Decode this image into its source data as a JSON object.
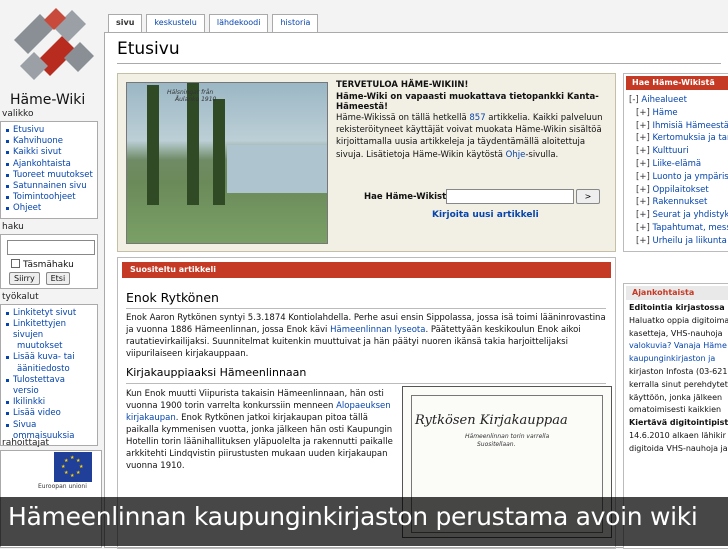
{
  "site": {
    "name": "Häme-Wiki"
  },
  "tabs": [
    "sivu",
    "keskustelu",
    "lähdekoodi",
    "historia"
  ],
  "page_title": "Etusivu",
  "sidebar": {
    "nav_title": "valikko",
    "nav_items": [
      "Etusivu",
      "Kahvihuone",
      "Kaikki sivut",
      "Ajankohtaista",
      "Tuoreet muutokset",
      "Satunnainen sivu",
      "Toimintoohjeet",
      "Ohjeet"
    ],
    "search_title": "haku",
    "search_caption": "Täsmähaku",
    "search_go": "Siirry",
    "search_find": "Etsi",
    "tools_title": "työkalut",
    "tools_items": [
      "Linkitetyt sivut",
      "Linkitettyjen sivujen",
      "muutokset",
      "Lisää kuva- tai",
      "äänitiedosto",
      "Tulostettava versio",
      "Ikilinkki",
      "Lisää video",
      "Sivua ommaisuuksia"
    ],
    "sponsors_title": "rahoittajat",
    "eu_label": "Euroopan unioni"
  },
  "welcome": {
    "photo_caption1": "Hälsningar från",
    "photo_caption2": "Åulanko 1910",
    "heading": "TERVETULOA HÄME-WIKIIN!",
    "subheading": "Häme-Wiki on vapaasti muokattava tietopankki Kanta-Hämeestä!",
    "body_before": "Häme-Wikissä on tällä hetkellä ",
    "article_count": "857",
    "body_middle": " artikkelia. Kaikki palveluun rekisteröityneet käyttäjät voivat muokata Häme-Wikin sisältöä kirjoittamalla uusia artikkeleja ja täydentämällä aloitettuja sivuja. Lisätietoja Häme-Wikin käytöstä ",
    "help_link": "Ohje",
    "body_after": "-sivulla.",
    "search_label": "Hae Häme-Wikistä",
    "search_button": ">",
    "new_article": "Kirjoita uusi artikkeli"
  },
  "portal": {
    "title": "Hae Häme-Wikistä",
    "items": [
      {
        "mark": "[-]",
        "label": "Aihealueet",
        "indent": false
      },
      {
        "mark": "[+]",
        "label": "Häme",
        "indent": true
      },
      {
        "mark": "[+]",
        "label": "Ihmisiä Hämeestä",
        "indent": true
      },
      {
        "mark": "[+]",
        "label": "Kertomuksia ja tar",
        "indent": true
      },
      {
        "mark": "[+]",
        "label": "Kulttuuri",
        "indent": true
      },
      {
        "mark": "[+]",
        "label": "Liike-elämä",
        "indent": true
      },
      {
        "mark": "[+]",
        "label": "Luonto ja ympärist",
        "indent": true
      },
      {
        "mark": "[+]",
        "label": "Oppilaitokset",
        "indent": true
      },
      {
        "mark": "[+]",
        "label": "Rakennukset",
        "indent": true
      },
      {
        "mark": "[+]",
        "label": "Seurat ja yhdistyks",
        "indent": true
      },
      {
        "mark": "[+]",
        "label": "Tapahtumat, mess",
        "indent": true
      },
      {
        "mark": "[+]",
        "label": "Urheilu ja liikunta",
        "indent": true
      }
    ]
  },
  "featured": {
    "header": "Suositeltu artikkeli",
    "title": "Enok Rytkönen",
    "p1_a": "Enok Aaron Rytkönen syntyi 5.3.1874 Kontiolahdella. Perhe asui ensin Sippolassa, jossa isä toimi lääninrovastina ja vuonna 1886 Hämeenlinnan, jossa Enok kävi ",
    "p1_link": "Hämeenlinnan lyseota",
    "p1_b": ". Päätettyään keskikoulun Enok aikoi rautatievirkailijaksi. Suunnitelmat kuitenkin muuttuivat ja hän päätyi nuoren ikänsä takia harjoittelijaksi viipurilaiseen kirjakauppaan.",
    "subtitle": "Kirjakauppiaaksi Hämeenlinnaan",
    "p2_a": "Kun Enok muutti Viipurista takaisin Hämeenlinnaan, hän osti vuonna 1900 torin varrelta konkurssiin menneen ",
    "p2_link1": "Alopaeuksen kirjakaupan",
    "p2_b": ". Enok Rytkönen jatkoi kirjakaupan pitoa tällä paikalla kymmenisen vuotta, jonka jälkeen hän osti Kaupungin Hotellin torin läänihallituksen yläpuolelta ja rakennutti paikalle arkkitehti Lindqvistin piirustusten mukaan uuden kirjakaupan vuonna 1910.",
    "clip_title": "Rytkösen Kirjakauppaa",
    "clip_s1": "Hämeenlinnan torin varrella",
    "clip_s2": "Suositellaan."
  },
  "news": {
    "title": "Ajankohtaista",
    "blocks": [
      {
        "head": "Editointia kirjastossa",
        "lines": [
          {
            "t": "Haluatko oppia digitoima",
            "link": false
          },
          {
            "t": "kasetteja, VHS-nauhoja",
            "link": false
          },
          {
            "t": "valokuvia? Vanaja Häme",
            "link": true
          },
          {
            "t": "kaupunginkirjaston ja",
            "link": true
          },
          {
            "t": "kirjaston Infosta (03-621",
            "link": false
          },
          {
            "t": "kerralla sinut perehdytet",
            "link": false
          },
          {
            "t": "käyttöön, jonka jälkeen",
            "link": false
          },
          {
            "t": "omatoimisesti kaikkien",
            "link": false
          }
        ]
      },
      {
        "head": "Kiertävä digitointipiste",
        "lines": [
          {
            "t": "14.6.2010 alkaen lähikir",
            "link": false
          },
          {
            "t": "digitoida VHS-nauhoja ja",
            "link": false
          }
        ]
      }
    ]
  },
  "caption": "Hämeenlinnan kaupunginkirjaston perustama avoin wiki"
}
